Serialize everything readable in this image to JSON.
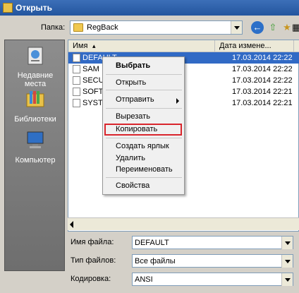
{
  "window": {
    "title": "Открыть"
  },
  "toolbar": {
    "folder_label": "Папка:",
    "folder_value": "RegBack"
  },
  "places": [
    {
      "label": "Недавние\nместа",
      "icon": "recent-places-icon"
    },
    {
      "label": "Библиотеки",
      "icon": "libraries-icon"
    },
    {
      "label": "Компьютер",
      "icon": "computer-icon"
    }
  ],
  "filelist": {
    "columns": [
      "Имя",
      "Дата измене..."
    ],
    "rows": [
      {
        "name": "DEFAULT",
        "date": "17.03.2014 22:22"
      },
      {
        "name": "SAM",
        "date": "17.03.2014 22:22"
      },
      {
        "name": "SECU",
        "date": "17.03.2014 22:22"
      },
      {
        "name": "SOFT",
        "date": "17.03.2014 22:21"
      },
      {
        "name": "SYSTE",
        "date": "17.03.2014 22:21"
      }
    ]
  },
  "context_menu": {
    "select": "Выбрать",
    "open": "Открыть",
    "send_to": "Отправить",
    "cut": "Вырезать",
    "copy": "Копировать",
    "create_shortcut": "Создать ярлык",
    "delete": "Удалить",
    "rename": "Переименовать",
    "properties": "Свойства"
  },
  "form": {
    "filename_label": "Имя файла:",
    "filename_value": "DEFAULT",
    "filetype_label": "Тип файлов:",
    "filetype_value": "Все файлы",
    "encoding_label": "Кодировка:",
    "encoding_value": "ANSI"
  },
  "colors": {
    "selection": "#316ac5",
    "highlight_box": "#d9252c"
  }
}
